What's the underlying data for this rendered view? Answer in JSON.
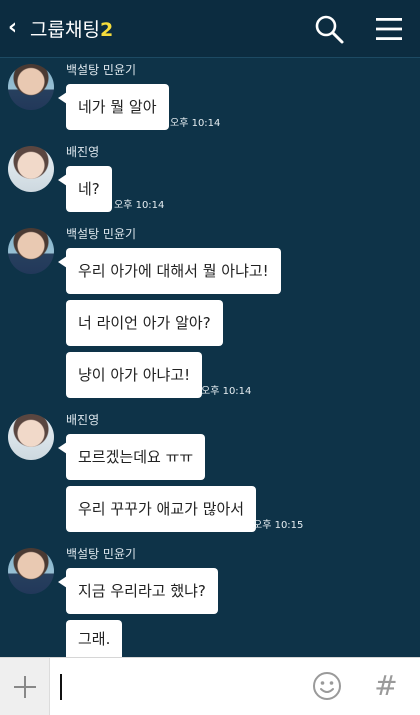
{
  "header": {
    "back_glyph": "‹",
    "title": "그룹채팅",
    "member_count": "2",
    "icons": [
      "chevron-left-icon",
      "search-icon",
      "menu-icon"
    ]
  },
  "messages": [
    {
      "sender": "백설탕 민윤기",
      "bubbles": [
        {
          "text": "네가 뭘 알아"
        }
      ],
      "time": "오후 10:14"
    },
    {
      "sender": "배진영",
      "bubbles": [
        {
          "text": "네?"
        }
      ],
      "time": "오후 10:14"
    },
    {
      "sender": "백설탕 민윤기",
      "bubbles": [
        {
          "text": "우리 아가에 대해서 뭘 아냐고!"
        },
        {
          "text": "너 라이언 아가 알아?"
        },
        {
          "text": "냥이 아가 아냐고!"
        }
      ],
      "time": "오후 10:14"
    },
    {
      "sender": "배진영",
      "bubbles": [
        {
          "text": "모르겠는데요 ㅠㅠ"
        },
        {
          "text": "우리 꾸꾸가 애교가 많아서"
        }
      ],
      "time": "오후 10:15"
    },
    {
      "sender": "백설탕 민윤기",
      "bubbles": [
        {
          "text": "지금 우리라고 했냐?"
        },
        {
          "text": "그래."
        }
      ]
    }
  ],
  "input": {
    "value": "",
    "plus_glyph": "+",
    "hash_glyph": "#",
    "icons": [
      "plus-icon",
      "emoji-icon",
      "hash-icon"
    ]
  },
  "colors": {
    "background": "#0e3348",
    "header": "#0c2c40",
    "bubble": "#ffffff",
    "member_count": "#f5dc3c"
  }
}
